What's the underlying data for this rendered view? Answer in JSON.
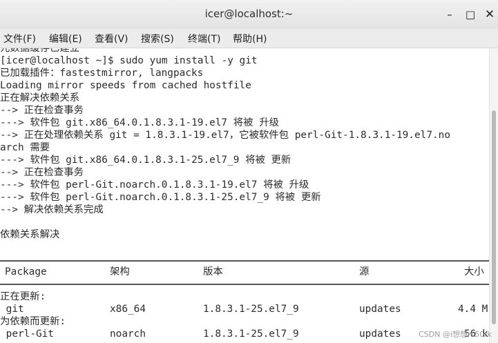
{
  "window": {
    "title": "icer@localhost:~",
    "buttons": {
      "minimize": "–",
      "maximize": "□",
      "close": "✕"
    }
  },
  "menu": [
    "文件(F)",
    "编辑(E)",
    "查看(V)",
    "搜索(S)",
    "终端(T)",
    "帮助(H)"
  ],
  "terminal": {
    "lines": [
      "元数据缓存已建立",
      "[icer@localhost ~]$ sudo yum install -y git",
      "已加载插件：fastestmirror, langpacks",
      "Loading mirror speeds from cached hostfile",
      "正在解决依赖关系",
      "--> 正在检查事务",
      "---> 软件包 git.x86_64.0.1.8.3.1-19.el7 将被 升级",
      "--> 正在处理依赖关系 git = 1.8.3.1-19.el7，它被软件包 perl-Git-1.8.3.1-19.el7.no",
      "arch 需要",
      "---> 软件包 git.x86_64.0.1.8.3.1-25.el7_9 将被 更新",
      "--> 正在检查事务",
      "---> 软件包 perl-Git.noarch.0.1.8.3.1-19.el7 将被 升级",
      "---> 软件包 perl-Git.noarch.0.1.8.3.1-25.el7_9 将被 更新",
      "--> 解决依赖关系完成",
      "",
      "依赖关系解决"
    ],
    "table": {
      "headers": [
        "Package",
        "架构",
        "版本",
        "源",
        "大小"
      ],
      "section_updating": "正在更新:",
      "section_dep_updating": "为依赖而更新:",
      "rows": [
        {
          "package": " git",
          "arch": "x86_64",
          "version": "1.8.3.1-25.el7_9",
          "repo": "updates",
          "size": "4.4 M"
        },
        {
          "package": " perl-Git",
          "arch": "noarch",
          "version": "1.8.3.1-25.el7_9",
          "repo": "updates",
          "size": "56 k"
        }
      ]
    }
  },
  "watermark": "CSDN @i想想rs50rk"
}
